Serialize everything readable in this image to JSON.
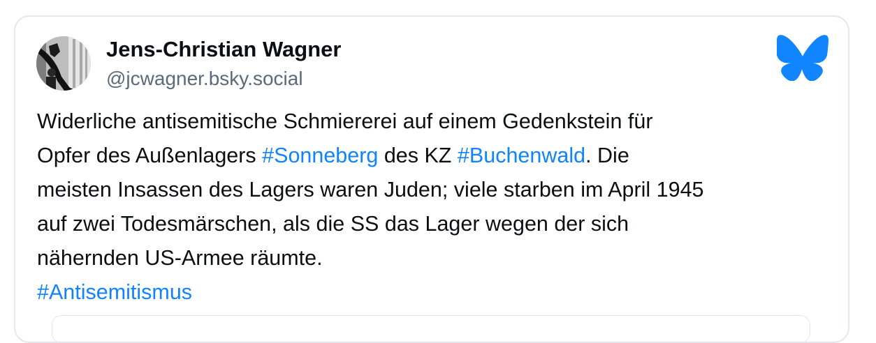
{
  "author": {
    "name": "Jens-Christian Wagner",
    "handle": "@jcwagner.bsky.social"
  },
  "icons": {
    "avatar": "avatar-photo",
    "logo": "bluesky-butterfly-icon"
  },
  "colors": {
    "hashtag": "#1083fe",
    "text": "#0b0f14",
    "handle": "#5b6a78",
    "border": "#e4e7eb",
    "logo": "#1185fe"
  },
  "post": {
    "line1": "Widerliche antisemitische Schmiererei auf einem Gedenkstein für",
    "line2_pre": "Opfer des Außenlagers ",
    "tag_sonneberg": "#Sonneberg",
    "line2_mid": " des KZ ",
    "tag_buchenwald": "#Buchenwald",
    "line2_post": ". Die",
    "line3": "meisten Insassen des Lagers waren Juden; viele starben im April 1945",
    "line4": "auf zwei Todesmärschen, als die SS das Lager wegen der sich",
    "line5": "nähernden US-Armee räumte.",
    "tag_antisemitismus": "#Antisemitismus"
  }
}
